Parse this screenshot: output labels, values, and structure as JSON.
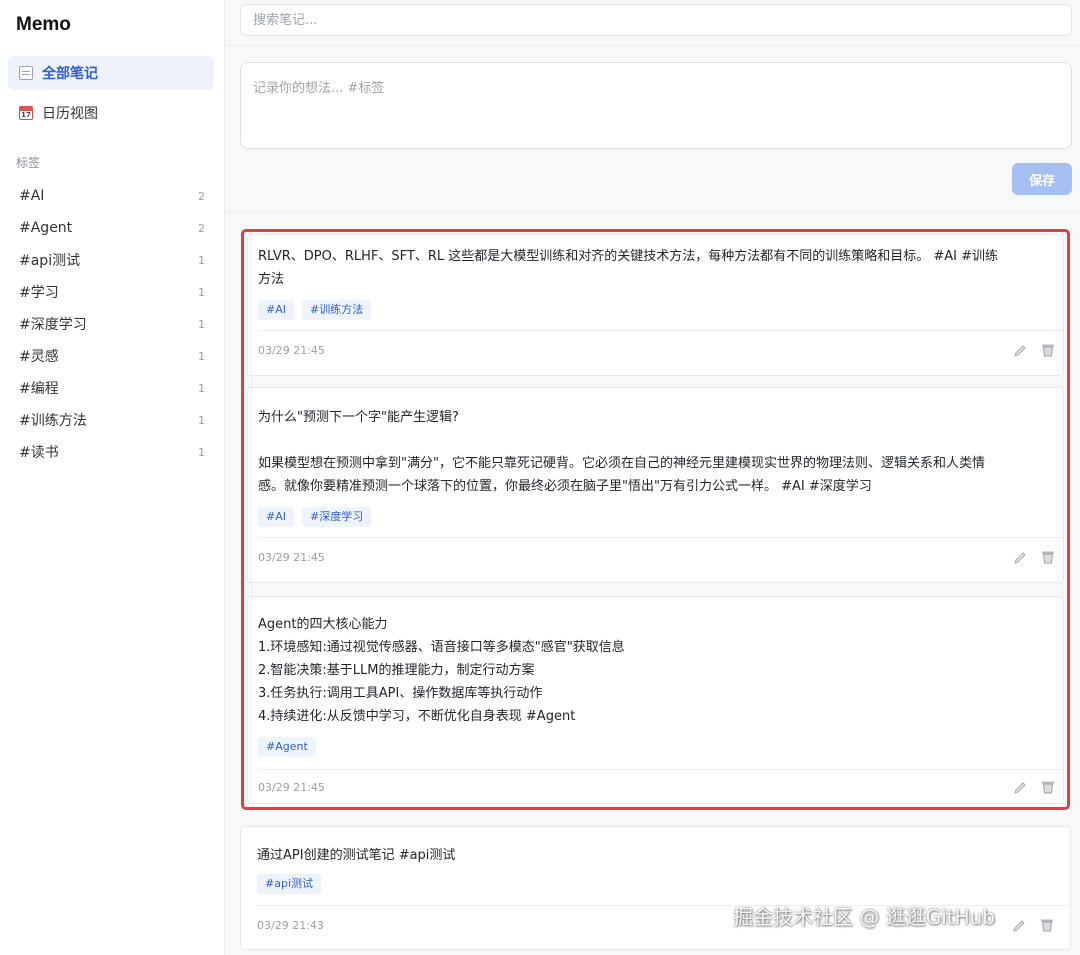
{
  "app": {
    "title": "Memo"
  },
  "sidebar": {
    "nav": [
      {
        "label": "全部笔记",
        "icon": "notes-icon",
        "active": true
      },
      {
        "label": "日历视图",
        "icon": "calendar-icon",
        "active": false
      }
    ],
    "tags_heading": "标签",
    "tags": [
      {
        "label": "#AI",
        "count": "2"
      },
      {
        "label": "#Agent",
        "count": "2"
      },
      {
        "label": "#api测试",
        "count": "1"
      },
      {
        "label": "#学习",
        "count": "1"
      },
      {
        "label": "#深度学习",
        "count": "1"
      },
      {
        "label": "#灵感",
        "count": "1"
      },
      {
        "label": "#编程",
        "count": "1"
      },
      {
        "label": "#训练方法",
        "count": "1"
      },
      {
        "label": "#读书",
        "count": "1"
      }
    ]
  },
  "search": {
    "placeholder": "搜索笔记..."
  },
  "composer": {
    "placeholder": "记录你的想法... #标签",
    "save_label": "保存"
  },
  "memos": [
    {
      "content": "RLVR、DPO、RLHF、SFT、RL 这些都是大模型训练和对齐的关键技术方法，每种方法都有不同的训练策略和目标。 #AI #训练\n方法",
      "tags": [
        "#AI",
        "#训练方法"
      ],
      "time": "03/29 21:45"
    },
    {
      "content": "为什么\"预测下一个字\"能产生逻辑?\n\n如果模型想在预测中拿到\"满分\"，它不能只靠死记硬背。它必须在自己的神经元里建模现实世界的物理法则、逻辑关系和人类情\n感。就像你要精准预测一个球落下的位置，你最终必须在脑子里\"悟出\"万有引力公式一样。 #AI #深度学习",
      "tags": [
        "#AI",
        "#深度学习"
      ],
      "time": "03/29 21:45"
    },
    {
      "content": "Agent的四大核心能力\n1.环境感知:通过视觉传感器、语音接口等多模态\"感官\"获取信息\n2.智能决策:基于LLM的推理能力，制定行动方案\n3.任务执行:调用工具API、操作数据库等执行动作\n4.持续进化:从反馈中学习，不断优化自身表现 #Agent",
      "tags": [
        "#Agent"
      ],
      "time": "03/29 21:45"
    },
    {
      "content": "通过API创建的测试笔记 #api测试",
      "tags": [
        "#api测试"
      ],
      "time": "03/29 21:43"
    }
  ],
  "watermark": "掘金技术社区 @ 逛逛GitHub",
  "colors": {
    "accent": "#2f5fcf",
    "highlight_border": "#e0403c",
    "save_button": "#a6bff3"
  }
}
